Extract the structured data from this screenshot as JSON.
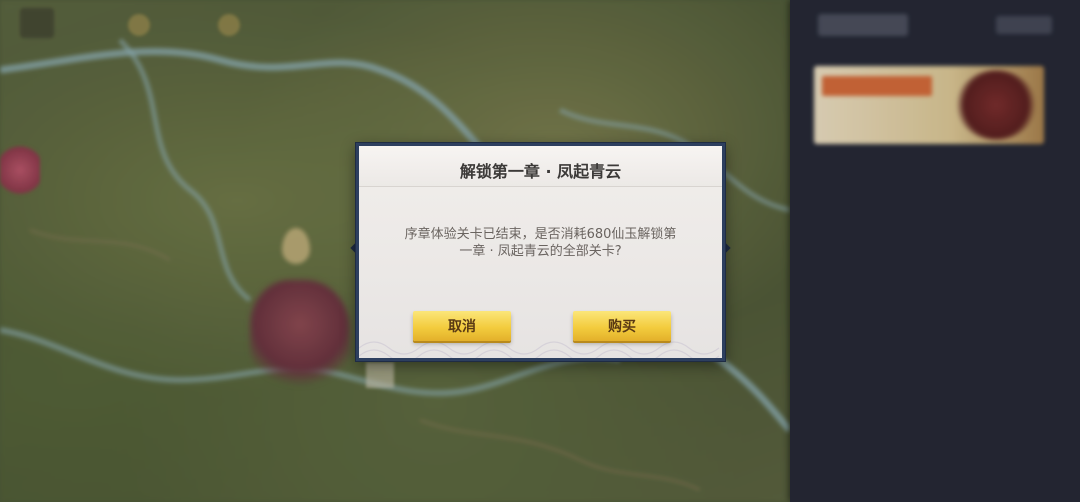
{
  "dialog": {
    "title": "解锁第一章 · 凤起青云",
    "message": "序章体验关卡已结束，是否消耗680仙玉解锁第一章 · 凤起青云的全部关卡?",
    "cancel_label": "取消",
    "buy_label": "购买"
  },
  "colors": {
    "dialog_border": "#2d3f5f",
    "button_gold": "#f3cc3e",
    "side_panel": "#262936"
  }
}
